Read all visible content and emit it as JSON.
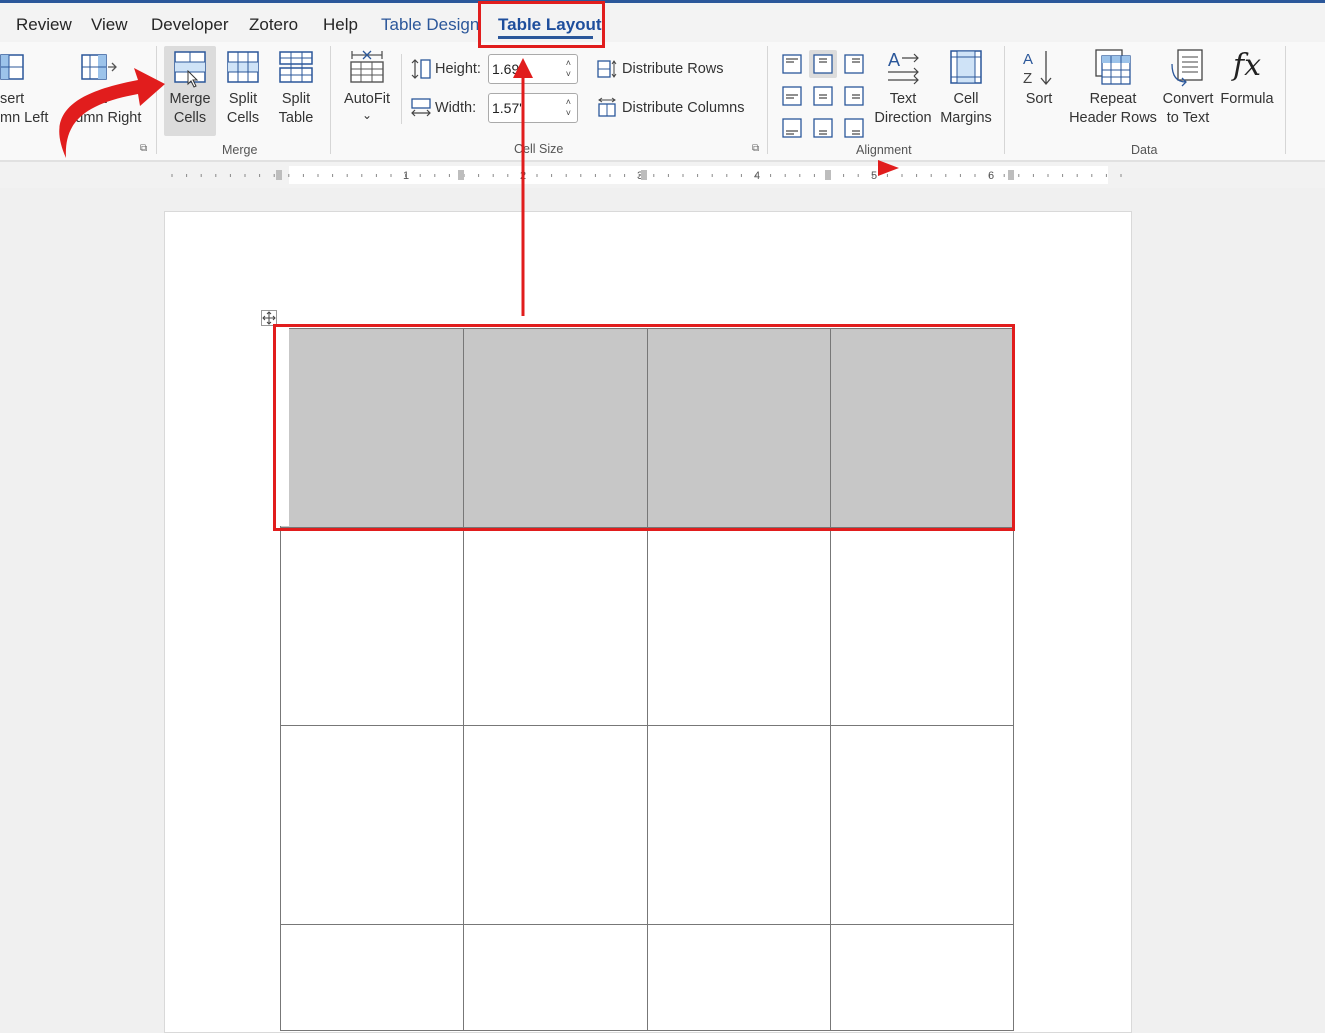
{
  "menu": {
    "tabs": [
      {
        "label": "Review"
      },
      {
        "label": "View"
      },
      {
        "label": "Developer"
      },
      {
        "label": "Zotero"
      },
      {
        "label": "Help"
      },
      {
        "label": "Table Design"
      },
      {
        "label": "Table Layout"
      }
    ],
    "active_tab": "Table Layout"
  },
  "ribbon": {
    "insert_left": {
      "line1": "sert",
      "line2": "mn Left"
    },
    "insert_right": {
      "line1": "ert",
      "line2": "olumn Right"
    },
    "merge_cells": {
      "line1": "Merge",
      "line2": "Cells"
    },
    "split_cells": {
      "line1": "Split",
      "line2": "Cells"
    },
    "split_table": {
      "line1": "Split",
      "line2": "Table"
    },
    "autofit": {
      "label": "AutoFit",
      "chevron": "⌄"
    },
    "height": {
      "label": "Height:",
      "value": "1.69"
    },
    "width": {
      "label": "Width:",
      "value": "1.57\""
    },
    "distribute_rows": "Distribute Rows",
    "distribute_columns": "Distribute Columns",
    "text_direction": {
      "line1": "Text",
      "line2": "Direction"
    },
    "cell_margins": {
      "line1": "Cell",
      "line2": "Margins"
    },
    "sort": "Sort",
    "repeat_header_rows": {
      "line1": "Repeat",
      "line2": "Header Rows"
    },
    "convert_to_text": {
      "line1": "Convert",
      "line2": "to Text"
    },
    "formula": {
      "label": "Formula",
      "glyph": "fx"
    },
    "groups": {
      "merge": "Merge",
      "cell_size": "Cell Size",
      "alignment": "Alignment",
      "data": "Data"
    }
  },
  "ruler": {
    "numbers": [
      "1",
      "2",
      "3",
      "4",
      "5",
      "6"
    ]
  },
  "table": {
    "rows": 4,
    "columns": 4,
    "selected_row": 1
  },
  "annotations": {
    "highlight_color": "#e11d1d"
  },
  "colors": {
    "accent": "#2b579a",
    "selection": "#c7c7c7"
  }
}
